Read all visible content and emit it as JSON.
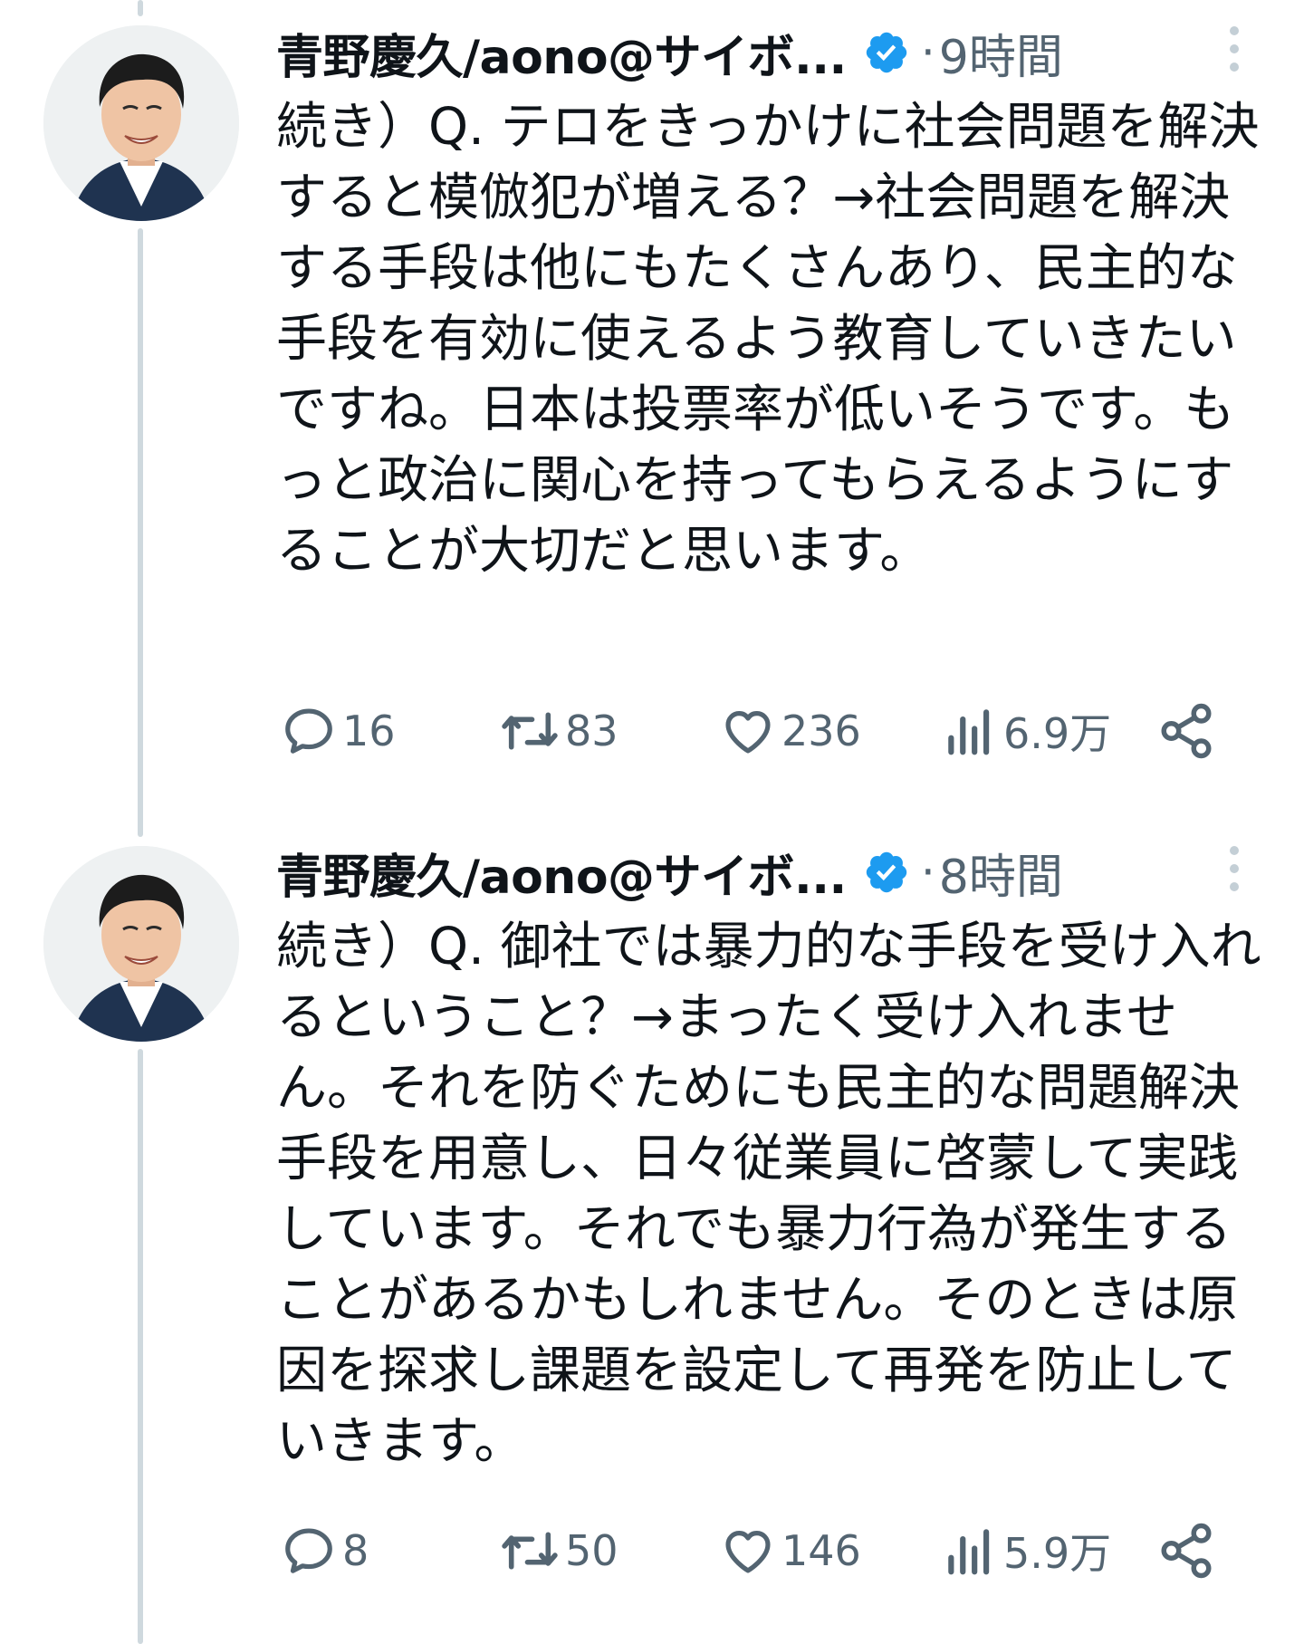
{
  "tweets": [
    {
      "author_name": "青野慶久/aono@サイボ...",
      "time": "9時間",
      "separator": "·",
      "text": "続き）Q. テロをきっかけに社会問題を解決すると模倣犯が増える？→社会問題を解決する手段は他にもたくさんあり、民主的な手段を有効に使えるよう教育していきたいですね。日本は投票率が低いそうです。もっと政治に関心を持ってもらえるようにすることが大切だと思います。",
      "replies": "16",
      "retweets": "83",
      "likes": "236",
      "views": "6.9万"
    },
    {
      "author_name": "青野慶久/aono@サイボ...",
      "time": "8時間",
      "separator": "·",
      "text": "続き）Q. 御社では暴力的な手段を受け入れるということ？→まったく受け入れません。それを防ぐためにも民主的な問題解決手段を用意し、日々従業員に啓蒙して実践しています。それでも暴力行為が発生することがあるかもしれません。そのときは原因を探求し課題を設定して再発を防止していきます。",
      "replies": "8",
      "retweets": "50",
      "likes": "146",
      "views": "5.9万"
    }
  ],
  "colors": {
    "text": "#0f1419",
    "secondary": "#536471",
    "verified": "#1d9bf0",
    "thread_line": "#cfd9de"
  },
  "icons": {
    "verified": "verified-badge-icon",
    "more": "more-vertical-icon",
    "reply": "reply-icon",
    "retweet": "retweet-icon",
    "like": "heart-icon",
    "views": "views-chart-icon",
    "share": "share-icon"
  }
}
